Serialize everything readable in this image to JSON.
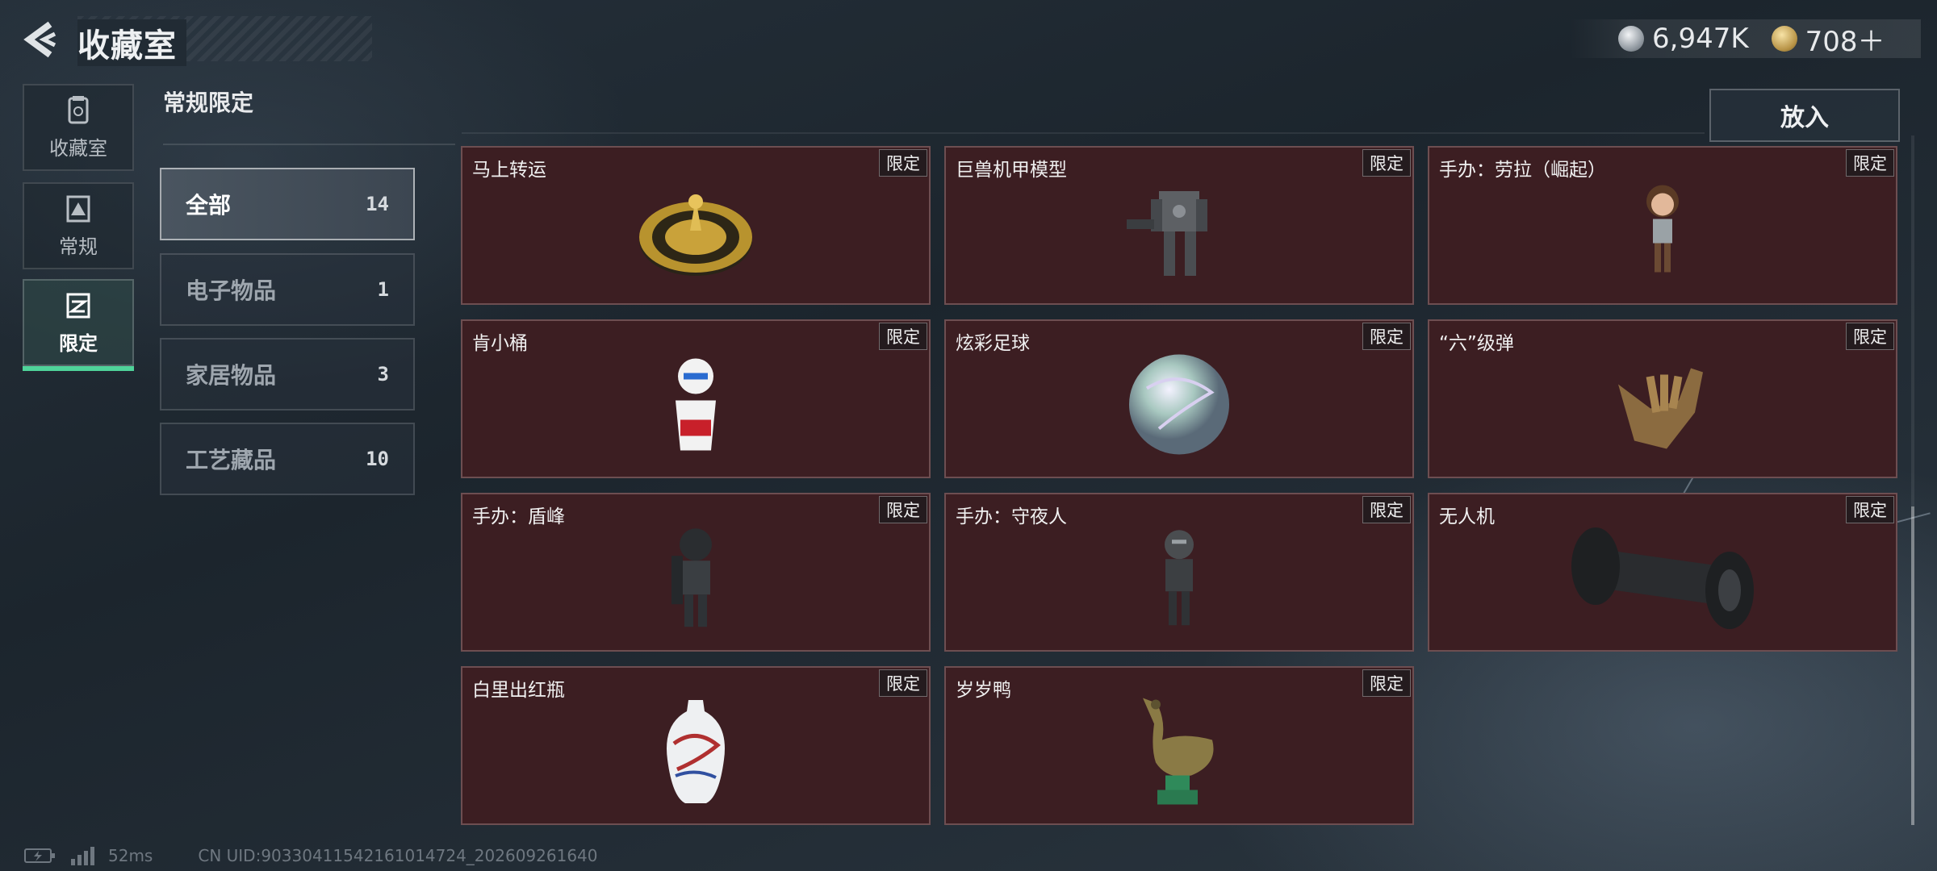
{
  "header": {
    "title": "收藏室",
    "currencies": [
      {
        "icon": "silver-coin-icon",
        "value": "6,947K"
      },
      {
        "icon": "gold-coin-icon",
        "value": "708＋"
      }
    ]
  },
  "nav": {
    "items": [
      {
        "label": "收藏室",
        "icon": "collection-room-icon",
        "active": false
      },
      {
        "label": "常规",
        "icon": "regular-icon",
        "active": false
      },
      {
        "label": "限定",
        "icon": "limited-icon",
        "active": true
      }
    ]
  },
  "section_title": "常规限定",
  "put_button": "放入",
  "categories": [
    {
      "label": "全部",
      "count": "14",
      "active": true
    },
    {
      "label": "电子物品",
      "count": "1",
      "active": false
    },
    {
      "label": "家居物品",
      "count": "3",
      "active": false
    },
    {
      "label": "工艺藏品",
      "count": "10",
      "active": false
    }
  ],
  "items": [
    {
      "name": "马上转运",
      "badge": "限定",
      "icon": "golden-compass-plate-icon"
    },
    {
      "name": "巨兽机甲模型",
      "badge": "限定",
      "icon": "mech-model-icon"
    },
    {
      "name": "手办：劳拉（崛起）",
      "badge": "限定",
      "icon": "lara-figure-icon"
    },
    {
      "name": "肯小桶",
      "badge": "限定",
      "icon": "kfc-bucket-figure-icon"
    },
    {
      "name": "炫彩足球",
      "badge": "限定",
      "icon": "iridescent-football-icon"
    },
    {
      "name": "“六”级弹",
      "badge": "限定",
      "icon": "bullet-hand-sculpture-icon"
    },
    {
      "name": "手办：盾峰",
      "badge": "限定",
      "icon": "shield-soldier-figure-icon"
    },
    {
      "name": "手办：守夜人",
      "badge": "限定",
      "icon": "night-watch-figure-icon"
    },
    {
      "name": "无人机",
      "badge": "限定",
      "icon": "drone-icon"
    },
    {
      "name": "白里出红瓶",
      "badge": "限定",
      "icon": "porcelain-vase-icon"
    },
    {
      "name": "岁岁鸭",
      "badge": "限定",
      "icon": "bronze-duck-icon"
    }
  ],
  "footer": {
    "ping": "52ms",
    "uid": "CN UID:90330411542161014724_202609261640"
  }
}
